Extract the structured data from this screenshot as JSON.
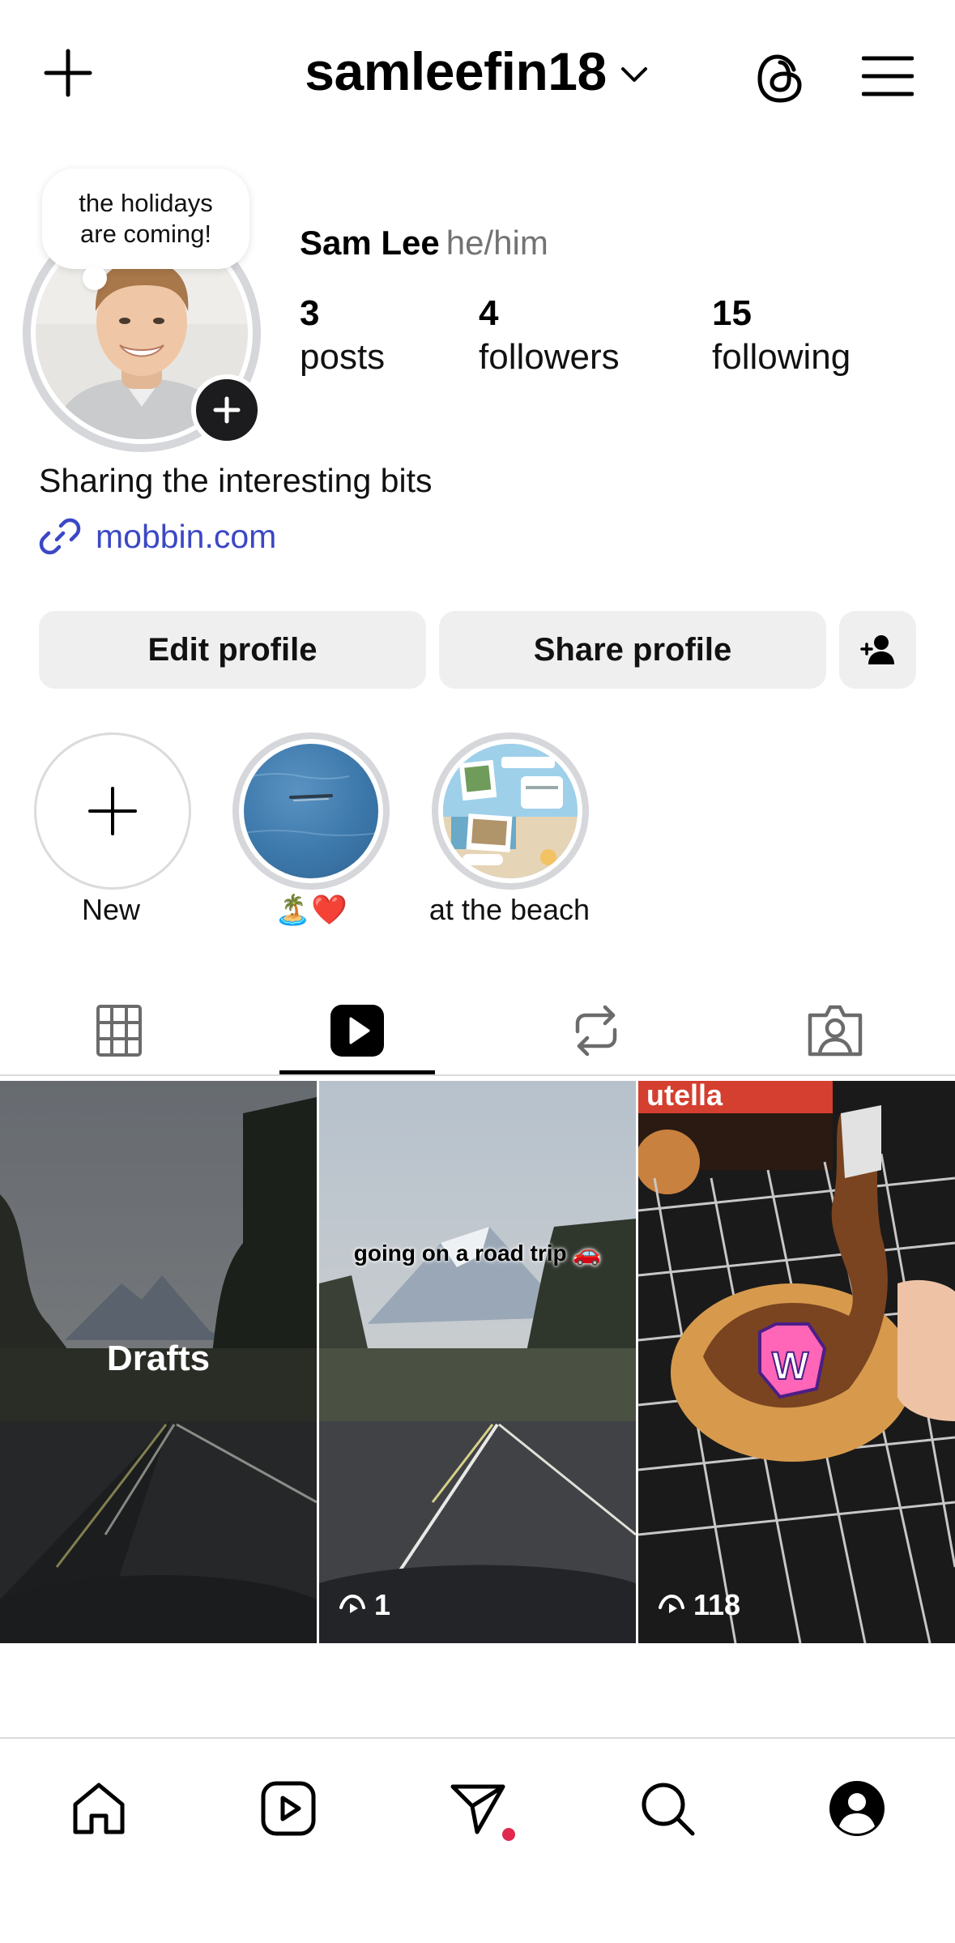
{
  "header": {
    "username": "samleefin18",
    "icons": [
      "add-icon",
      "chevron-down-icon",
      "threads-icon",
      "hamburger-menu-icon"
    ]
  },
  "profile": {
    "note": "the holidays are coming!",
    "display_name": "Sam Lee",
    "pronouns": "he/him",
    "stats": [
      {
        "number": "3",
        "label": "posts"
      },
      {
        "number": "4",
        "label": "followers"
      },
      {
        "number": "15",
        "label": "following"
      }
    ],
    "bio": "Sharing the interesting bits",
    "link": "mobbin.com"
  },
  "actions": {
    "edit": "Edit profile",
    "share": "Share profile"
  },
  "highlights": [
    {
      "label": "New"
    },
    {
      "label": "🏝️❤️"
    },
    {
      "label": "at the beach"
    }
  ],
  "tabs": [
    "grid-icon",
    "reels-icon",
    "reposts-icon",
    "tagged-icon"
  ],
  "active_tab": "reels",
  "reels": [
    {
      "overlay": "Drafts",
      "views": ""
    },
    {
      "caption": "going on a road trip 🚗",
      "views": "1"
    },
    {
      "sticker": "W",
      "views": "118"
    }
  ],
  "nav": [
    "home-icon",
    "reels-icon",
    "messages-icon",
    "search-icon",
    "profile-icon"
  ],
  "colors": {
    "link": "#3b48c4",
    "notification": "#e1306c",
    "button_bg": "#efefef"
  }
}
